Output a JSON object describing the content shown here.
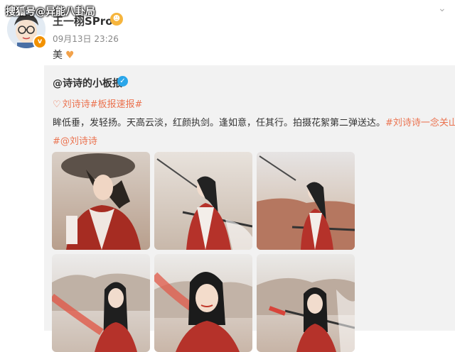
{
  "watermark": "搜狐号@异能八卦局",
  "post": {
    "username": "王一栩SPro",
    "timestamp": "09月13日 23:26",
    "text": "美"
  },
  "repost": {
    "author": "@诗诗的小板报",
    "super_topic": "刘诗诗#板报速报#",
    "body_text": "眸低垂，发轻扬。天高云淡，红颜执剑。逢如意，任其行。拍摄花絮第二弹送达。",
    "topic_inline": "#刘诗诗一念关山",
    "topic_line2": "#@刘诗诗",
    "photos": [
      {
        "name": "photo-1",
        "desc": "hat"
      },
      {
        "name": "photo-2",
        "desc": "sword-1"
      },
      {
        "name": "photo-3",
        "desc": "sword-2"
      },
      {
        "name": "photo-4",
        "desc": "desert-1"
      },
      {
        "name": "photo-5",
        "desc": "desert-2"
      },
      {
        "name": "photo-6",
        "desc": "desert-3"
      }
    ]
  },
  "colors": {
    "topic": "#eb7350",
    "card_bg": "#f2f2f2",
    "verified": "#2aa6ea"
  }
}
